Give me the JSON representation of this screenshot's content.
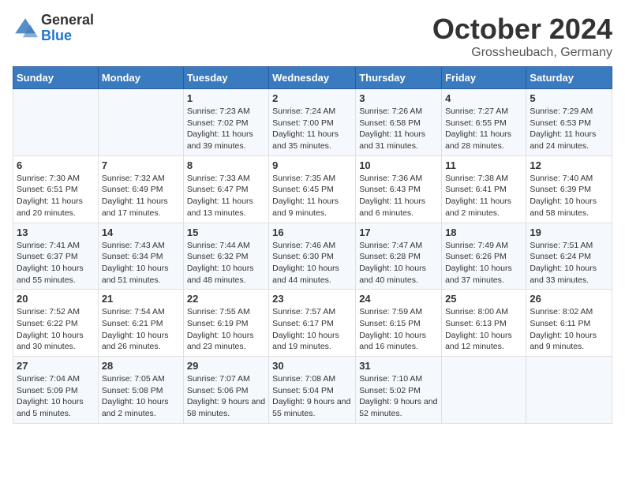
{
  "header": {
    "logo_general": "General",
    "logo_blue": "Blue",
    "month": "October 2024",
    "location": "Grossheubach, Germany"
  },
  "weekdays": [
    "Sunday",
    "Monday",
    "Tuesday",
    "Wednesday",
    "Thursday",
    "Friday",
    "Saturday"
  ],
  "weeks": [
    [
      {
        "day": "",
        "info": ""
      },
      {
        "day": "",
        "info": ""
      },
      {
        "day": "1",
        "info": "Sunrise: 7:23 AM\nSunset: 7:02 PM\nDaylight: 11 hours and 39 minutes."
      },
      {
        "day": "2",
        "info": "Sunrise: 7:24 AM\nSunset: 7:00 PM\nDaylight: 11 hours and 35 minutes."
      },
      {
        "day": "3",
        "info": "Sunrise: 7:26 AM\nSunset: 6:58 PM\nDaylight: 11 hours and 31 minutes."
      },
      {
        "day": "4",
        "info": "Sunrise: 7:27 AM\nSunset: 6:55 PM\nDaylight: 11 hours and 28 minutes."
      },
      {
        "day": "5",
        "info": "Sunrise: 7:29 AM\nSunset: 6:53 PM\nDaylight: 11 hours and 24 minutes."
      }
    ],
    [
      {
        "day": "6",
        "info": "Sunrise: 7:30 AM\nSunset: 6:51 PM\nDaylight: 11 hours and 20 minutes."
      },
      {
        "day": "7",
        "info": "Sunrise: 7:32 AM\nSunset: 6:49 PM\nDaylight: 11 hours and 17 minutes."
      },
      {
        "day": "8",
        "info": "Sunrise: 7:33 AM\nSunset: 6:47 PM\nDaylight: 11 hours and 13 minutes."
      },
      {
        "day": "9",
        "info": "Sunrise: 7:35 AM\nSunset: 6:45 PM\nDaylight: 11 hours and 9 minutes."
      },
      {
        "day": "10",
        "info": "Sunrise: 7:36 AM\nSunset: 6:43 PM\nDaylight: 11 hours and 6 minutes."
      },
      {
        "day": "11",
        "info": "Sunrise: 7:38 AM\nSunset: 6:41 PM\nDaylight: 11 hours and 2 minutes."
      },
      {
        "day": "12",
        "info": "Sunrise: 7:40 AM\nSunset: 6:39 PM\nDaylight: 10 hours and 58 minutes."
      }
    ],
    [
      {
        "day": "13",
        "info": "Sunrise: 7:41 AM\nSunset: 6:37 PM\nDaylight: 10 hours and 55 minutes."
      },
      {
        "day": "14",
        "info": "Sunrise: 7:43 AM\nSunset: 6:34 PM\nDaylight: 10 hours and 51 minutes."
      },
      {
        "day": "15",
        "info": "Sunrise: 7:44 AM\nSunset: 6:32 PM\nDaylight: 10 hours and 48 minutes."
      },
      {
        "day": "16",
        "info": "Sunrise: 7:46 AM\nSunset: 6:30 PM\nDaylight: 10 hours and 44 minutes."
      },
      {
        "day": "17",
        "info": "Sunrise: 7:47 AM\nSunset: 6:28 PM\nDaylight: 10 hours and 40 minutes."
      },
      {
        "day": "18",
        "info": "Sunrise: 7:49 AM\nSunset: 6:26 PM\nDaylight: 10 hours and 37 minutes."
      },
      {
        "day": "19",
        "info": "Sunrise: 7:51 AM\nSunset: 6:24 PM\nDaylight: 10 hours and 33 minutes."
      }
    ],
    [
      {
        "day": "20",
        "info": "Sunrise: 7:52 AM\nSunset: 6:22 PM\nDaylight: 10 hours and 30 minutes."
      },
      {
        "day": "21",
        "info": "Sunrise: 7:54 AM\nSunset: 6:21 PM\nDaylight: 10 hours and 26 minutes."
      },
      {
        "day": "22",
        "info": "Sunrise: 7:55 AM\nSunset: 6:19 PM\nDaylight: 10 hours and 23 minutes."
      },
      {
        "day": "23",
        "info": "Sunrise: 7:57 AM\nSunset: 6:17 PM\nDaylight: 10 hours and 19 minutes."
      },
      {
        "day": "24",
        "info": "Sunrise: 7:59 AM\nSunset: 6:15 PM\nDaylight: 10 hours and 16 minutes."
      },
      {
        "day": "25",
        "info": "Sunrise: 8:00 AM\nSunset: 6:13 PM\nDaylight: 10 hours and 12 minutes."
      },
      {
        "day": "26",
        "info": "Sunrise: 8:02 AM\nSunset: 6:11 PM\nDaylight: 10 hours and 9 minutes."
      }
    ],
    [
      {
        "day": "27",
        "info": "Sunrise: 7:04 AM\nSunset: 5:09 PM\nDaylight: 10 hours and 5 minutes."
      },
      {
        "day": "28",
        "info": "Sunrise: 7:05 AM\nSunset: 5:08 PM\nDaylight: 10 hours and 2 minutes."
      },
      {
        "day": "29",
        "info": "Sunrise: 7:07 AM\nSunset: 5:06 PM\nDaylight: 9 hours and 58 minutes."
      },
      {
        "day": "30",
        "info": "Sunrise: 7:08 AM\nSunset: 5:04 PM\nDaylight: 9 hours and 55 minutes."
      },
      {
        "day": "31",
        "info": "Sunrise: 7:10 AM\nSunset: 5:02 PM\nDaylight: 9 hours and 52 minutes."
      },
      {
        "day": "",
        "info": ""
      },
      {
        "day": "",
        "info": ""
      }
    ]
  ]
}
